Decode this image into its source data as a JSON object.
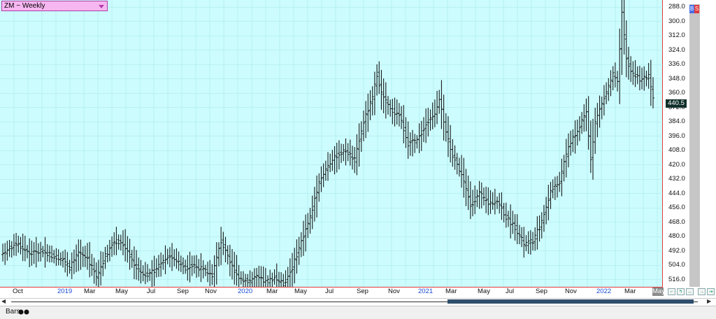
{
  "header": {
    "symbol": "ZM ~ Weekly"
  },
  "price_axis": {
    "ticks": [
      "516.0",
      "504.0",
      "492.0",
      "480.0",
      "468.0",
      "456.0",
      "444.0",
      "432.0",
      "420.0",
      "408.0",
      "396.0",
      "384.0",
      "372.0",
      "360.0",
      "348.0",
      "336.0",
      "324.0",
      "312.0",
      "300.0",
      "288.0"
    ],
    "last_price": "440.5"
  },
  "badge": {
    "b": "B",
    "s": "S",
    "colors": {
      "b": "#4c6fe6",
      "s": "#e23a3a"
    }
  },
  "time_axis": {
    "labels": [
      {
        "text": "Oct",
        "year": false
      },
      {
        "text": "2019",
        "year": true
      },
      {
        "text": "Mar",
        "year": false
      },
      {
        "text": "May",
        "year": false
      },
      {
        "text": "Jul",
        "year": false
      },
      {
        "text": "Sep",
        "year": false
      },
      {
        "text": "Nov",
        "year": false
      },
      {
        "text": "2020",
        "year": true
      },
      {
        "text": "Mar",
        "year": false
      },
      {
        "text": "May",
        "year": false
      },
      {
        "text": "Jul",
        "year": false
      },
      {
        "text": "Sep",
        "year": false
      },
      {
        "text": "Nov",
        "year": false
      },
      {
        "text": "2021",
        "year": true
      },
      {
        "text": "Mar",
        "year": false
      },
      {
        "text": "May",
        "year": false
      },
      {
        "text": "Jul",
        "year": false
      },
      {
        "text": "Sep",
        "year": false
      },
      {
        "text": "Nov",
        "year": false
      },
      {
        "text": "2022",
        "year": true
      },
      {
        "text": "Mar",
        "year": false
      }
    ],
    "current_month": "May"
  },
  "bottom": {
    "tab_label": "Bars",
    "tab_icon": "bars-chart-icon"
  },
  "colors": {
    "background": "#ccfcfd",
    "grid": "#a8e6ec",
    "bars": "#1a1a1a",
    "axis_divider": "#e23a3a",
    "year_label": "#1a4bd6"
  },
  "chart_data": {
    "type": "bar",
    "style": "ohlc",
    "ylim": [
      282,
      522
    ],
    "yticks": [
      288,
      300,
      312,
      324,
      336,
      348,
      360,
      372,
      384,
      396,
      408,
      420,
      432,
      444,
      456,
      468,
      480,
      492,
      504,
      516
    ],
    "grid": true,
    "x": [
      "Oct",
      "2019",
      "Mar",
      "May",
      "Jul",
      "Sep",
      "Nov",
      "2020",
      "Mar",
      "May",
      "Jul",
      "Sep",
      "Nov",
      "2021",
      "Mar",
      "May",
      "Jul",
      "Sep",
      "Nov",
      "2022",
      "Mar",
      "May"
    ],
    "anchors": [
      [
        0,
        310
      ],
      [
        6,
        318
      ],
      [
        12,
        310
      ],
      [
        18,
        312
      ],
      [
        22,
        308
      ],
      [
        26,
        306
      ],
      [
        30,
        298
      ],
      [
        34,
        310
      ],
      [
        38,
        306
      ],
      [
        42,
        290
      ],
      [
        46,
        308
      ],
      [
        50,
        320
      ],
      [
        54,
        318
      ],
      [
        58,
        304
      ],
      [
        62,
        294
      ],
      [
        66,
        292
      ],
      [
        70,
        300
      ],
      [
        74,
        308
      ],
      [
        78,
        304
      ],
      [
        82,
        298
      ],
      [
        86,
        300
      ],
      [
        90,
        296
      ],
      [
        94,
        292
      ],
      [
        98,
        320
      ],
      [
        102,
        302
      ],
      [
        106,
        290
      ],
      [
        110,
        286
      ],
      [
        114,
        290
      ],
      [
        118,
        286
      ],
      [
        122,
        290
      ],
      [
        126,
        284
      ],
      [
        130,
        298
      ],
      [
        134,
        320
      ],
      [
        138,
        340
      ],
      [
        142,
        370
      ],
      [
        146,
        384
      ],
      [
        150,
        392
      ],
      [
        154,
        396
      ],
      [
        158,
        388
      ],
      [
        162,
        420
      ],
      [
        166,
        440
      ],
      [
        168,
        460
      ],
      [
        170,
        444
      ],
      [
        174,
        430
      ],
      [
        178,
        426
      ],
      [
        182,
        402
      ],
      [
        186,
        404
      ],
      [
        190,
        418
      ],
      [
        194,
        428
      ],
      [
        196,
        440
      ],
      [
        198,
        418
      ],
      [
        202,
        392
      ],
      [
        206,
        376
      ],
      [
        210,
        350
      ],
      [
        214,
        360
      ],
      [
        218,
        352
      ],
      [
        222,
        354
      ],
      [
        226,
        340
      ],
      [
        230,
        332
      ],
      [
        234,
        318
      ],
      [
        238,
        320
      ],
      [
        242,
        336
      ],
      [
        246,
        362
      ],
      [
        250,
        370
      ],
      [
        254,
        400
      ],
      [
        258,
        412
      ],
      [
        262,
        428
      ],
      [
        264,
        390
      ],
      [
        266,
        420
      ],
      [
        270,
        440
      ],
      [
        274,
        460
      ],
      [
        276,
        452
      ],
      [
        278,
        510
      ],
      [
        280,
        472
      ],
      [
        282,
        462
      ],
      [
        286,
        456
      ],
      [
        290,
        458
      ],
      [
        292,
        440
      ]
    ]
  }
}
